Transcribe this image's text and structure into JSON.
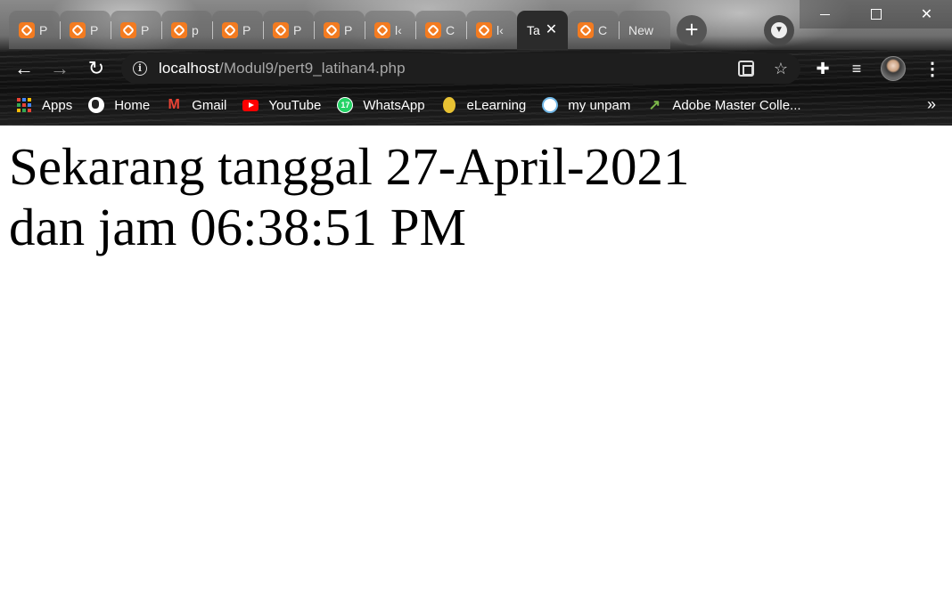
{
  "window": {
    "minimize_label": "—",
    "maximize_label": "",
    "close_label": "✕"
  },
  "tabs": [
    {
      "title": "P",
      "favicon": "xampp-icon",
      "active": false
    },
    {
      "title": "P",
      "favicon": "xampp-icon",
      "active": false
    },
    {
      "title": "P",
      "favicon": "xampp-icon",
      "active": false
    },
    {
      "title": "p",
      "favicon": "xampp-icon",
      "active": false
    },
    {
      "title": "P",
      "favicon": "xampp-icon",
      "active": false
    },
    {
      "title": "P",
      "favicon": "xampp-icon",
      "active": false
    },
    {
      "title": "P",
      "favicon": "xampp-icon",
      "active": false
    },
    {
      "title": "l‹",
      "favicon": "xampp-icon",
      "active": false
    },
    {
      "title": "C",
      "favicon": "xampp-icon",
      "active": false
    },
    {
      "title": "l‹",
      "favicon": "xampp-icon",
      "active": false
    },
    {
      "title": "Ta",
      "favicon": "",
      "active": true
    },
    {
      "title": "C",
      "favicon": "xampp-icon",
      "active": false
    },
    {
      "title": "New",
      "favicon": "",
      "active": false
    }
  ],
  "tab_close_glyph": "✕",
  "new_tab_glyph": "+",
  "omnibox": {
    "host": "localhost",
    "path": "/Modul9/pert9_latihan4.php"
  },
  "bookmarks": [
    {
      "label": "Apps",
      "icon": "apps-grid-icon"
    },
    {
      "label": "Home",
      "icon": "globe-icon"
    },
    {
      "label": "Gmail",
      "icon": "gmail-icon"
    },
    {
      "label": "YouTube",
      "icon": "youtube-icon"
    },
    {
      "label": "WhatsApp",
      "icon": "whatsapp-icon",
      "badge": "17"
    },
    {
      "label": "eLearning",
      "icon": "elearning-icon"
    },
    {
      "label": "my unpam",
      "icon": "unpam-icon"
    },
    {
      "label": "Adobe Master Colle...",
      "icon": "adobe-icon"
    }
  ],
  "bookmarks_overflow": "»",
  "page": {
    "line1": "Sekarang tanggal 27-April-2021",
    "line2": "dan jam 06:38:51 PM"
  },
  "colors": {
    "xampp_orange": "#f37b20",
    "omnibox_bg": "#1e1e1e",
    "url_path": "#a8a8a8"
  }
}
